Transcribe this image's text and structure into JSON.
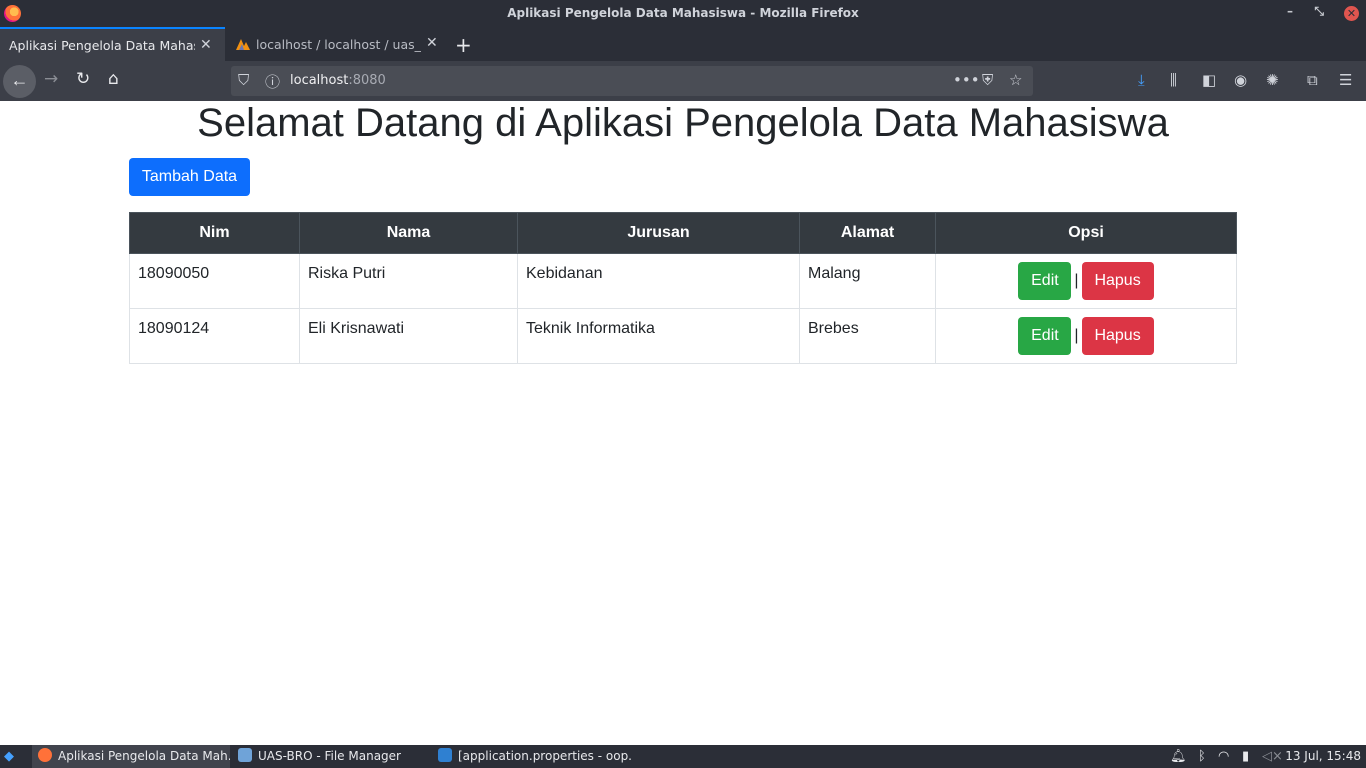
{
  "window": {
    "title": "Aplikasi Pengelola Data Mahasiswa - Mozilla Firefox"
  },
  "tabs": [
    {
      "label": "Aplikasi Pengelola Data Mahasiswa",
      "active": true
    },
    {
      "label": "localhost / localhost / uas_oop",
      "active": false
    }
  ],
  "urlbar": {
    "host": "localhost",
    "port": ":8080"
  },
  "page": {
    "heading": "Selamat Datang di Aplikasi Pengelola Data Mahasiswa",
    "add_button": "Tambah Data",
    "table": {
      "headers": [
        "Nim",
        "Nama",
        "Jurusan",
        "Alamat",
        "Opsi"
      ],
      "rows": [
        {
          "nim": "18090050",
          "nama": "Riska Putri",
          "jurusan": "Kebidanan",
          "alamat": "Malang"
        },
        {
          "nim": "18090124",
          "nama": "Eli Krisnawati",
          "jurusan": "Teknik Informatika",
          "alamat": "Brebes"
        }
      ],
      "edit_label": "Edit",
      "separator": "|",
      "delete_label": "Hapus"
    }
  },
  "taskbar": {
    "items": [
      {
        "label": "Aplikasi Pengelola Data Mah...",
        "active": true
      },
      {
        "label": "UAS-BRO - File Manager",
        "active": false
      },
      {
        "label": "[application.properties - oop...",
        "active": false
      }
    ],
    "clock": "13 Jul, 15:48"
  },
  "colors": {
    "primary": "#0d6efd",
    "success": "#28a745",
    "danger": "#dc3545",
    "table_header": "#343a40"
  }
}
